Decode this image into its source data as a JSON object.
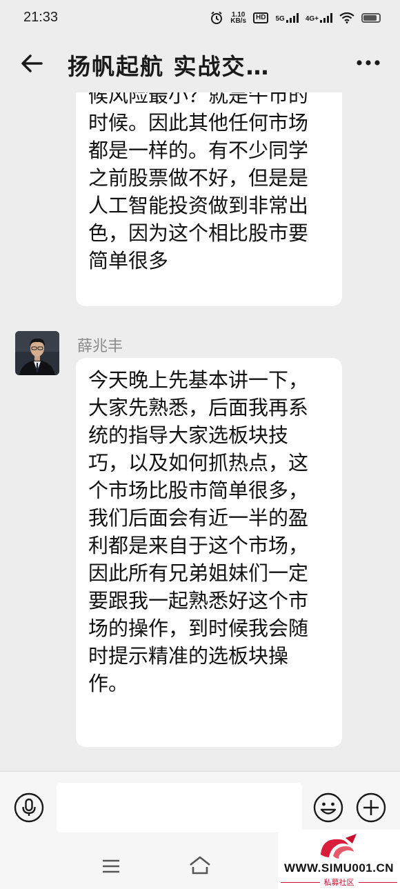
{
  "status_bar": {
    "time": "21:33",
    "speed_value": "1.10",
    "speed_unit": "KB/s",
    "hd_badge": "HD",
    "net_5g": "5G",
    "net_4g": "4G+",
    "battery_level": 0.85
  },
  "header": {
    "title": "扬帆起航 实战交…"
  },
  "messages": [
    {
      "lines": [
        "候风险最小？就是牛市的",
        "时候。因此其他任何市场",
        "都是一样的。有不少同学",
        "之前股票做不好，但是是",
        "人工智能投资做到非常出",
        "色，因为这个相比股市要",
        "简单很多"
      ]
    },
    {
      "sender": "薛兆丰",
      "lines": [
        "今天晚上先基本讲一下，",
        "大家先熟悉，后面我再系",
        "统的指导大家选板块技",
        "巧，以及如何抓热点，这",
        "个市场比股市简单很多，",
        "我们后面会有近一半的盈",
        "利都是来自于这个市场，",
        "因此所有兄弟姐妹们一定",
        "要跟我一起熟悉好这个市",
        "场的操作，到时候我会随",
        "时提示精准的选板块操",
        "作。"
      ]
    }
  ],
  "input_bar": {
    "message_value": ""
  },
  "watermark": {
    "url": "WWW.SIMU001.CN",
    "subtitle": "私募社区"
  },
  "colors": {
    "background": "#ededed",
    "bubble": "#ffffff",
    "watermark_red": "#c8102e"
  }
}
